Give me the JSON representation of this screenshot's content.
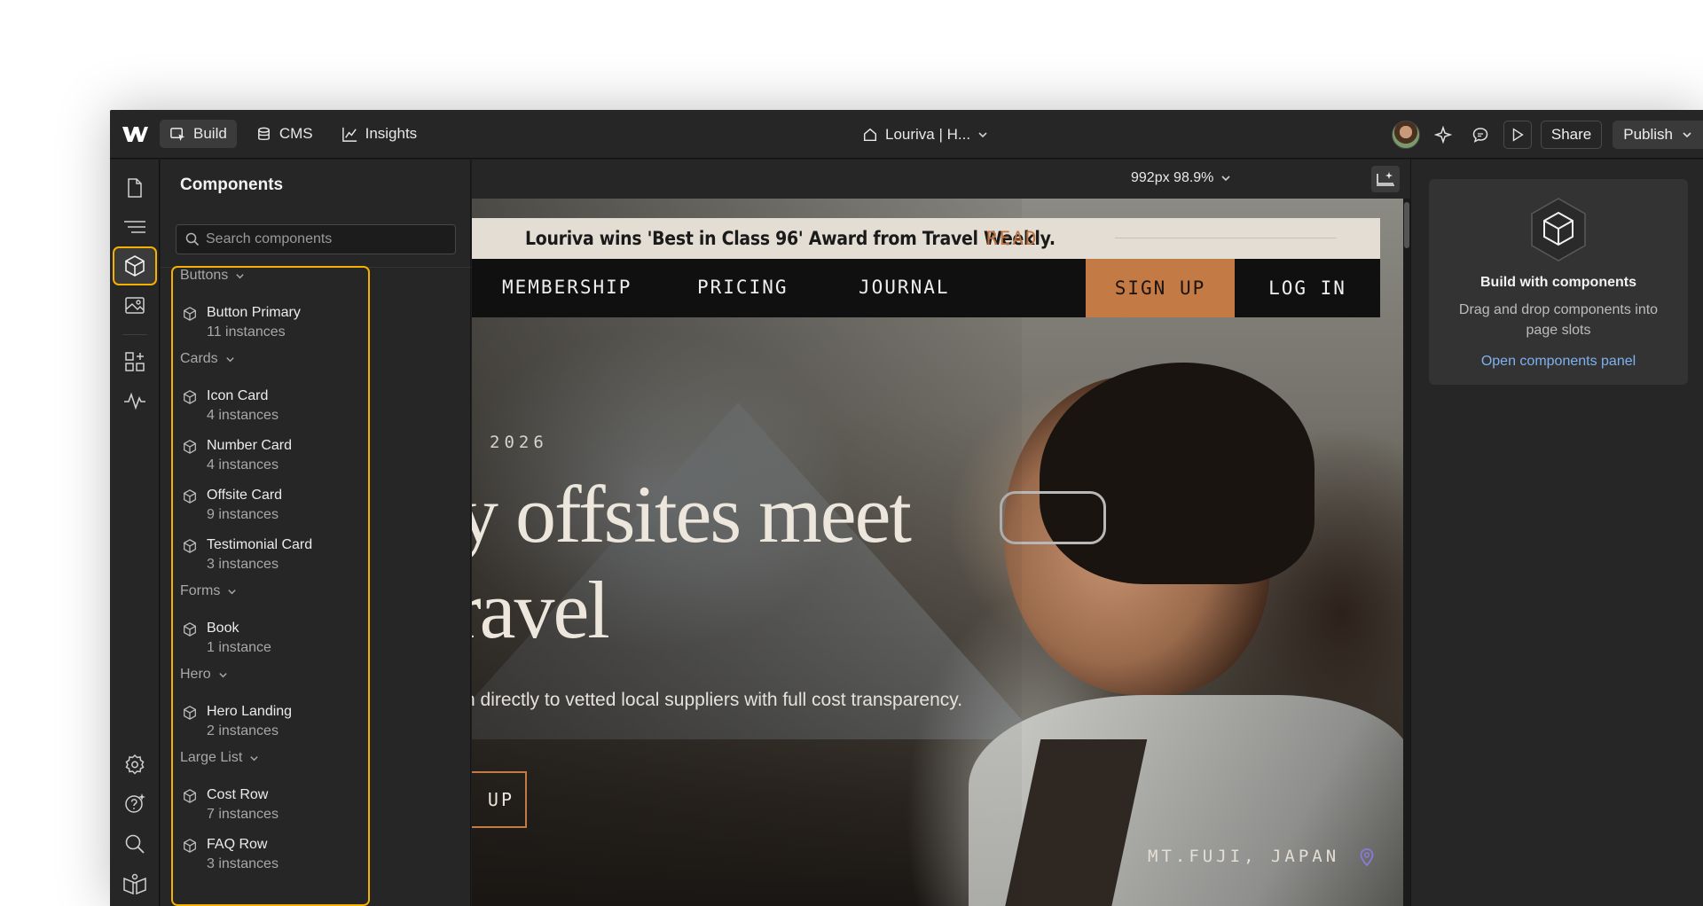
{
  "topbar": {
    "nav": [
      {
        "label": "Build",
        "icon": "cursor-icon",
        "active": true
      },
      {
        "label": "CMS",
        "icon": "database-icon",
        "active": false
      },
      {
        "label": "Insights",
        "icon": "chart-line-icon",
        "active": false
      }
    ],
    "page_name": "Louriva | H...",
    "share_label": "Share",
    "publish_label": "Publish"
  },
  "rail": [
    "pages-icon",
    "navigator-icon",
    "components-icon",
    "assets-icon",
    "apps-icon",
    "activity-icon",
    "settings-icon",
    "help-icon",
    "search-icon",
    "tutorials-icon"
  ],
  "panel": {
    "title": "Components",
    "search_placeholder": "Search components",
    "groups": [
      {
        "name": "Buttons",
        "items": [
          {
            "name": "Button Primary",
            "count": "11 instances"
          }
        ]
      },
      {
        "name": "Cards",
        "items": [
          {
            "name": "Icon Card",
            "count": "4 instances"
          },
          {
            "name": "Number Card",
            "count": "4 instances"
          },
          {
            "name": "Offsite Card",
            "count": "9 instances"
          },
          {
            "name": "Testimonial Card",
            "count": "3 instances"
          }
        ]
      },
      {
        "name": "Forms",
        "items": [
          {
            "name": "Book",
            "count": "1 instance"
          }
        ]
      },
      {
        "name": "Hero",
        "items": [
          {
            "name": "Hero Landing",
            "count": "2 instances"
          }
        ]
      },
      {
        "name": "Large List",
        "items": [
          {
            "name": "Cost Row",
            "count": "7 instances"
          },
          {
            "name": "FAQ Row",
            "count": "3 instances"
          }
        ]
      }
    ]
  },
  "canvas": {
    "zoom_label": "992px 98.9%",
    "site": {
      "announcement": "Louriva wins 'Best in Class 96' Award from Travel Weekly.",
      "announcement_link": "READ",
      "nav": [
        "MEMBERSHIP",
        "PRICING",
        "JOURNAL"
      ],
      "signup": "SIGN UP",
      "login": "LOG IN",
      "eyebrow": "2026",
      "headline_1": "ny offsites meet",
      "headline_2": "ravel",
      "subline": "n directly to vetted local suppliers with full cost transparency.",
      "cta": "UP",
      "location": "MT.FUJI, JAPAN"
    }
  },
  "right_panel": {
    "title": "Build with components",
    "description": "Drag and drop components into page slots",
    "link": "Open components panel"
  },
  "colors": {
    "accent": "#f5b000",
    "brand": "#c47a45",
    "link": "#7fb1f0"
  }
}
